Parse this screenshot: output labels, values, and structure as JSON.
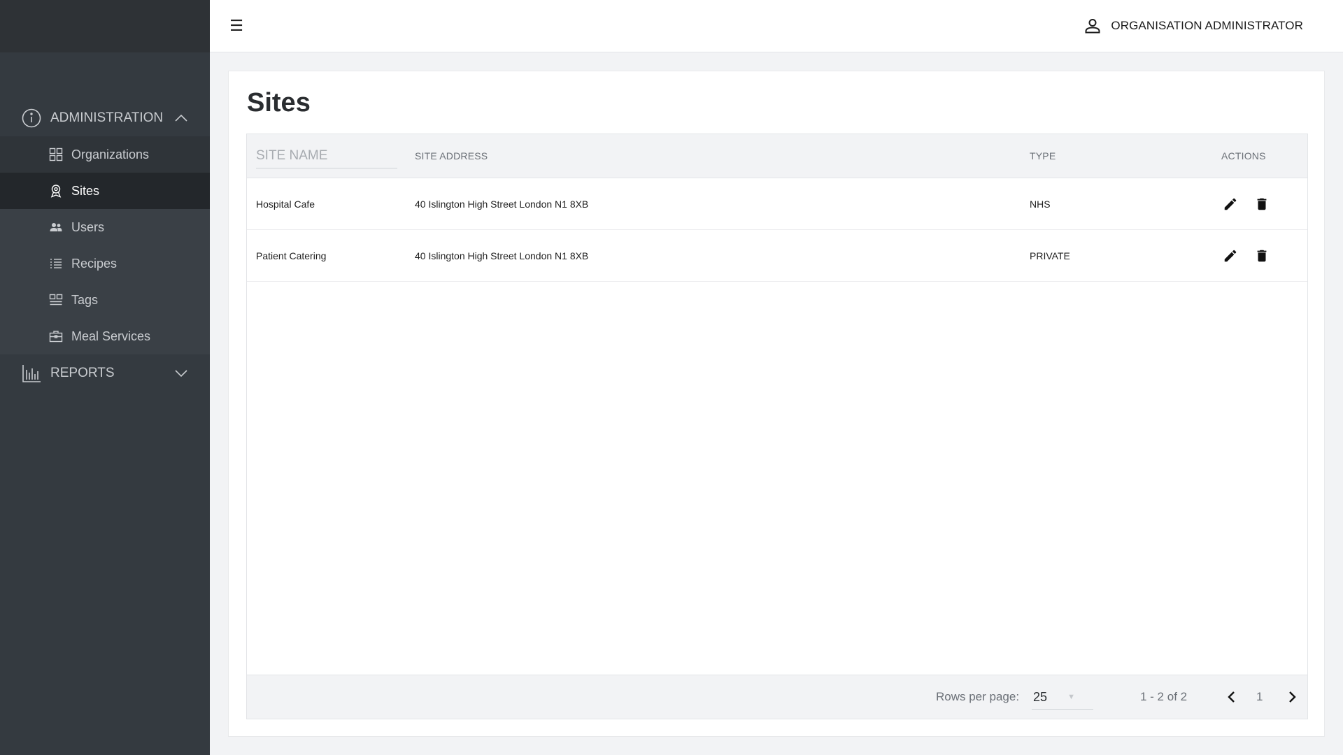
{
  "sidebar": {
    "sections": {
      "administration": {
        "label": "ADMINISTRATION",
        "icon": "info-icon",
        "expanded": true
      },
      "reports": {
        "label": "REPORTS",
        "icon": "bar-chart-icon",
        "expanded": false
      }
    },
    "items": [
      {
        "label": "Organizations",
        "icon": "grid-icon"
      },
      {
        "label": "Sites",
        "icon": "location-badge-icon",
        "active": true
      },
      {
        "label": "Users",
        "icon": "users-icon"
      },
      {
        "label": "Recipes",
        "icon": "list-icon"
      },
      {
        "label": "Tags",
        "icon": "tags-grid-icon"
      },
      {
        "label": "Meal Services",
        "icon": "briefcase-icon"
      }
    ]
  },
  "topbar": {
    "menu_glyph": "☰",
    "user_label": "ORGANISATION ADMINISTRATOR"
  },
  "page": {
    "title": "Sites"
  },
  "table": {
    "search_placeholder": "SITE NAME",
    "headers": {
      "address": "SITE ADDRESS",
      "type": "TYPE",
      "actions": "ACTIONS"
    },
    "rows": [
      {
        "name": "Hospital Cafe",
        "address": "40 Islington High Street London N1 8XB",
        "type": "NHS"
      },
      {
        "name": "Patient Catering",
        "address": "40 Islington High Street London N1 8XB",
        "type": "PRIVATE"
      }
    ],
    "footer": {
      "rows_per_page_label": "Rows per page:",
      "rows_per_page_value": "25",
      "range": "1 - 2 of 2",
      "page": "1"
    }
  },
  "colors": {
    "sidebar_bg": "#343a40",
    "sidebar_active": "#23272b",
    "page_bg": "#f2f3f5"
  }
}
